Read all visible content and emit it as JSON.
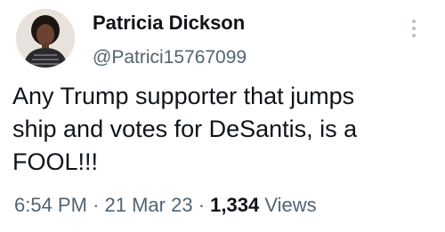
{
  "tweet": {
    "author": {
      "name": "Patricia Dickson",
      "handle": "@Patrici15767099"
    },
    "text": "Any Trump supporter that jumps\nship and votes for DeSantis, is a\nFOOL!!!",
    "time": "6:54 PM",
    "date": "21 Mar 23",
    "separator": "·",
    "views_count": "1,334",
    "views_label": "Views"
  },
  "colors": {
    "text_primary": "#0f1419",
    "text_secondary": "#536471",
    "more_icon": "#b9c1c8"
  }
}
